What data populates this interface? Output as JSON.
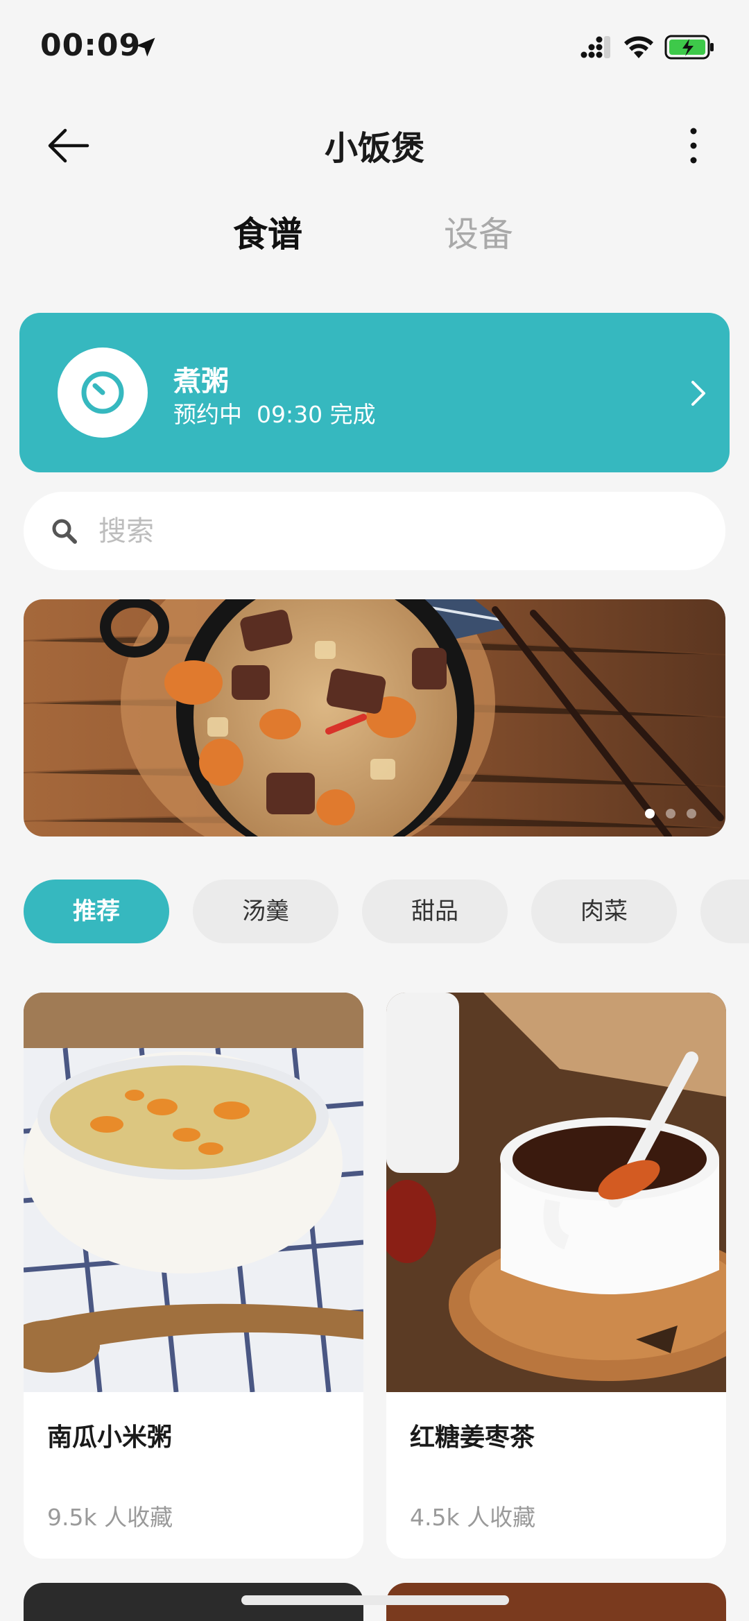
{
  "status_bar": {
    "time": "00:09"
  },
  "header": {
    "title": "小饭煲"
  },
  "tabs": [
    {
      "label": "食谱",
      "active": true
    },
    {
      "label": "设备",
      "active": false
    }
  ],
  "status_card": {
    "title": "煮粥",
    "state": "预约中",
    "time": "09:30 完成",
    "accent_color": "#36b8bf"
  },
  "search": {
    "placeholder": "搜索",
    "value": ""
  },
  "banner": {
    "image": "rice-with-beef-and-carrots-photo",
    "slides": 3,
    "active_slide": 1
  },
  "categories": [
    {
      "label": "推荐",
      "active": true
    },
    {
      "label": "汤羹",
      "active": false
    },
    {
      "label": "甜品",
      "active": false
    },
    {
      "label": "肉菜",
      "active": false
    }
  ],
  "recipes": [
    {
      "name": "南瓜小米粥",
      "favorites": "9.5k 人收藏",
      "image": "pumpkin-millet-porridge-photo"
    },
    {
      "name": "红糖姜枣茶",
      "favorites": "4.5k 人收藏",
      "image": "brown-sugar-ginger-date-tea-photo"
    }
  ],
  "icons": {
    "back": "back-arrow-icon",
    "more": "more-vertical-icon",
    "timer": "timer-icon",
    "arrow": "chevron-right-icon",
    "search": "search-icon"
  }
}
